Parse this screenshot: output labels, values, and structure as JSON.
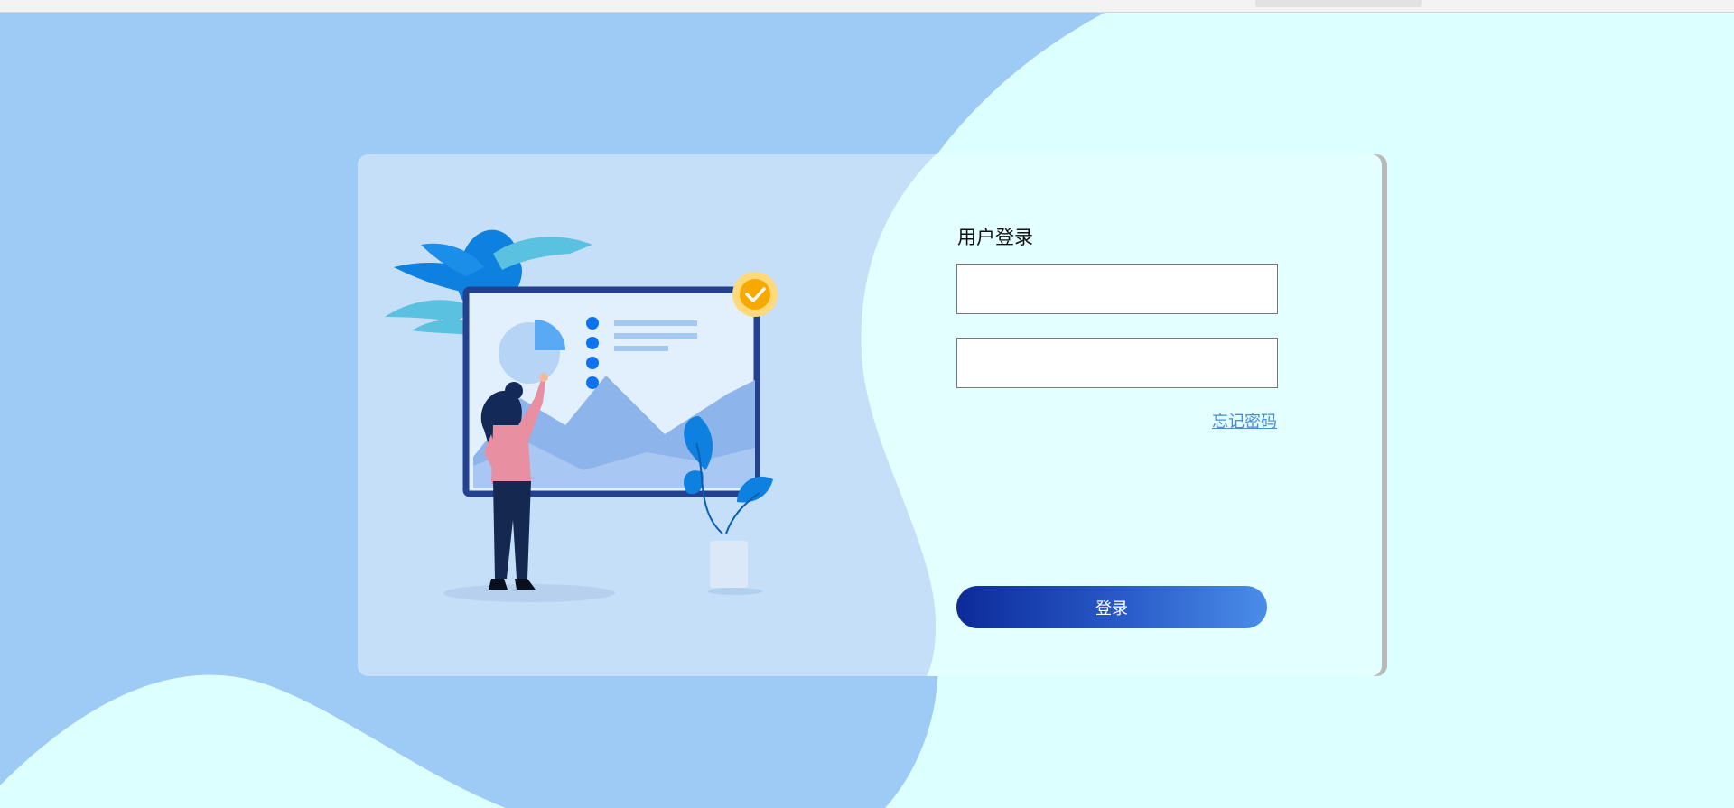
{
  "login": {
    "title": "用户登录",
    "username": {
      "value": "",
      "placeholder": ""
    },
    "password": {
      "value": "",
      "placeholder": ""
    },
    "forgot_password": "忘记密码",
    "submit_label": "登录"
  },
  "colors": {
    "page_background": "#dcffff",
    "blob_blue": "#9ecbf5",
    "button_gradient_start": "#0c2a9a",
    "button_gradient_end": "#4a8de8",
    "link": "#4a8bd8"
  },
  "illustration": {
    "subject": "woman-presenting-at-dashboard-board",
    "icons": [
      "palm-leaves-icon",
      "pie-chart-icon",
      "checkmark-badge-icon",
      "potted-plant-icon"
    ]
  }
}
